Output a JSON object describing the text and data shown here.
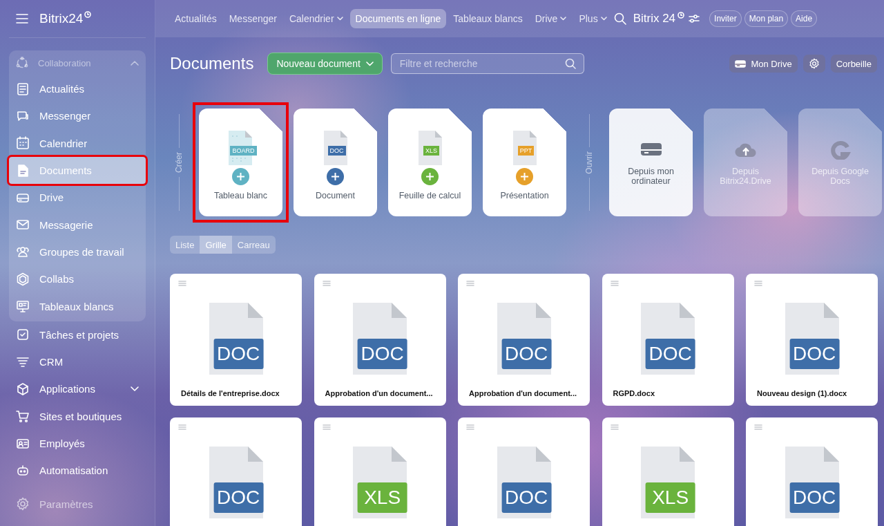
{
  "sidebar": {
    "logo": "Bitrix24",
    "group": {
      "label": "Collaboration",
      "expanded": true,
      "items": [
        {
          "label": "Actualités",
          "selected": false,
          "annotated": false
        },
        {
          "label": "Messenger",
          "selected": false,
          "annotated": false
        },
        {
          "label": "Calendrier",
          "selected": false,
          "annotated": false
        },
        {
          "label": "Documents",
          "selected": true,
          "annotated": true
        },
        {
          "label": "Drive",
          "selected": false,
          "annotated": false
        },
        {
          "label": "Messagerie",
          "selected": false,
          "annotated": false
        },
        {
          "label": "Groupes de travail",
          "selected": false,
          "annotated": false
        },
        {
          "label": "Collabs",
          "selected": false,
          "annotated": false
        },
        {
          "label": "Tableaux blancs",
          "selected": false,
          "annotated": false
        }
      ]
    },
    "items": [
      {
        "label": "Tâches et projets",
        "has_submenu": false
      },
      {
        "label": "CRM",
        "has_submenu": false
      },
      {
        "label": "Applications",
        "has_submenu": true
      },
      {
        "label": "Sites et boutiques",
        "has_submenu": false
      },
      {
        "label": "Employés",
        "has_submenu": false
      },
      {
        "label": "Automatisation",
        "has_submenu": false
      }
    ],
    "settings": "Paramètres"
  },
  "topbar": {
    "items": [
      {
        "label": "Actualités",
        "dropdown": false,
        "selected": false
      },
      {
        "label": "Messenger",
        "dropdown": false,
        "selected": false
      },
      {
        "label": "Calendrier",
        "dropdown": true,
        "selected": false
      },
      {
        "label": "Documents en ligne",
        "dropdown": false,
        "selected": true
      },
      {
        "label": "Tableaux blancs",
        "dropdown": false,
        "selected": false
      },
      {
        "label": "Drive",
        "dropdown": true,
        "selected": false
      },
      {
        "label": "Plus",
        "dropdown": true,
        "selected": false
      }
    ],
    "brand": "Bitrix 24",
    "buttons": [
      "Inviter",
      "Mon plan",
      "Aide"
    ]
  },
  "toolbar": {
    "title": "Documents",
    "new_button": "Nouveau document",
    "search": {
      "placeholder": "Filtre et recherche"
    },
    "drive_button": "Mon Drive",
    "trash_button": "Corbeille"
  },
  "create": {
    "label": "Créer",
    "items": [
      {
        "name": "Tableau blanc",
        "badge": "BOARD",
        "kind": "board",
        "annotated": true
      },
      {
        "name": "Document",
        "badge": "DOC",
        "kind": "doc",
        "annotated": false
      },
      {
        "name": "Feuille de calcul",
        "badge": "XLS",
        "kind": "xls",
        "annotated": false
      },
      {
        "name": "Présentation",
        "badge": "PPT",
        "kind": "ppt",
        "annotated": false
      }
    ]
  },
  "open": {
    "label": "Ouvrir",
    "items": [
      {
        "name": "Depuis mon ordinateur",
        "disabled": false
      },
      {
        "name": "Depuis Bitrix24.Drive",
        "disabled": true
      },
      {
        "name": "Depuis Google Docs",
        "disabled": true
      }
    ]
  },
  "view_switch": [
    {
      "label": "Liste",
      "selected": false
    },
    {
      "label": "Grille",
      "selected": true
    },
    {
      "label": "Carreau",
      "selected": false
    }
  ],
  "files": [
    {
      "name": "Détails de l'entreprise.docx",
      "kind": "doc",
      "badge": "DOC"
    },
    {
      "name": "Approbation d'un document...",
      "kind": "doc",
      "badge": "DOC"
    },
    {
      "name": "Approbation d'un document...",
      "kind": "doc",
      "badge": "DOC"
    },
    {
      "name": "RGPD.docx",
      "kind": "doc",
      "badge": "DOC"
    },
    {
      "name": "Nouveau design (1).docx",
      "kind": "doc",
      "badge": "DOC"
    },
    {
      "kind": "doc",
      "badge": "DOC"
    },
    {
      "kind": "xls",
      "badge": "XLS"
    },
    {
      "kind": "doc",
      "badge": "DOC"
    },
    {
      "kind": "xls",
      "badge": "XLS"
    },
    {
      "kind": "doc",
      "badge": "DOC"
    }
  ]
}
